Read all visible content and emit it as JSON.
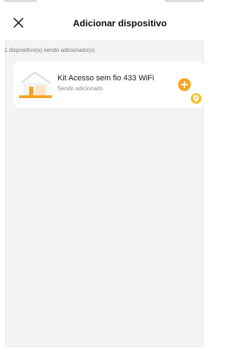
{
  "header": {
    "title": "Adicionar dispositivo"
  },
  "list": {
    "count_label": "1 dispositivo(s) sendo adicionado(s)",
    "devices": [
      {
        "name": "Kit Acesso sem fio 433 WiFi",
        "status": "Sendo adicionado"
      }
    ]
  },
  "icons": {
    "close": "close-icon",
    "add": "plus-circle-icon",
    "pin": "location-pin-icon",
    "device": "house-device-icon"
  },
  "colors": {
    "accent": "#f5a623",
    "pin_badge": "#f5c12b",
    "background": "#f4f4f4",
    "card": "#ffffff"
  }
}
